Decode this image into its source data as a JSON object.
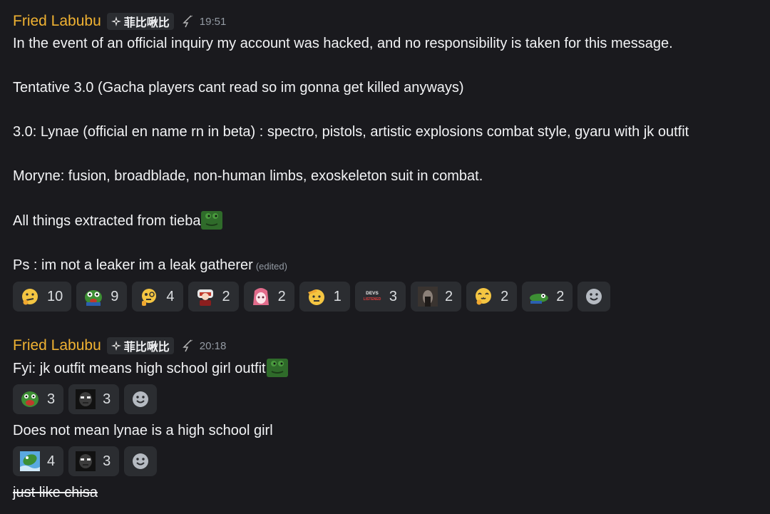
{
  "messages": [
    {
      "author": "Fried Labubu",
      "tag": "菲比啾比",
      "time": "19:51",
      "lines": [
        "In the event of an official inquiry  my account was hacked, and no responsibility is taken for this message.",
        "Tentative 3.0 (Gacha players cant read so im gonna get killed anyways)",
        "3.0: Lynae (official en name rn in beta) : spectro, pistols, artistic explosions combat style, gyaru with jk outfit",
        "Moryne: fusion, broadblade, non-human limbs, exoskeleton suit in combat.",
        "All things extracted from tieba",
        "Ps : im not a leaker im a leak gatherer"
      ],
      "edited": "(edited)",
      "reactions": [
        {
          "icon": "thinking-face-icon",
          "count": "10"
        },
        {
          "icon": "pepe-hands-icon",
          "count": "9"
        },
        {
          "icon": "monocle-face-icon",
          "count": "4"
        },
        {
          "icon": "chibi-character-icon",
          "count": "2"
        },
        {
          "icon": "anime-girl-icon",
          "count": "2"
        },
        {
          "icon": "salute-face-icon",
          "count": "1"
        },
        {
          "icon": "devs-listened-icon",
          "count": "3",
          "label": "DEVS LISTENED"
        },
        {
          "icon": "dark-photo-icon",
          "count": "2"
        },
        {
          "icon": "uwu-face-icon",
          "count": "2"
        },
        {
          "icon": "pepe-lying-icon",
          "count": "2"
        }
      ]
    },
    {
      "author": "Fried Labubu",
      "tag": "菲比啾比",
      "time": "20:18",
      "blocks": [
        {
          "text": "Fyi: jk outfit means high school girl outfit",
          "reactions": [
            {
              "icon": "pepe-shout-icon",
              "count": "3"
            },
            {
              "icon": "dark-face-icon",
              "count": "3"
            }
          ]
        },
        {
          "text": "Does not mean lynae is a high school girl",
          "reactions": [
            {
              "icon": "pepe-swim-icon",
              "count": "4"
            },
            {
              "icon": "dark-face-icon",
              "count": "3"
            }
          ]
        },
        {
          "text": "just like chisa"
        }
      ]
    }
  ],
  "colors": {
    "background": "#1a1a1e",
    "author": "#f0b232",
    "chip": "#2b2d31",
    "timestamp": "#949ba4"
  }
}
